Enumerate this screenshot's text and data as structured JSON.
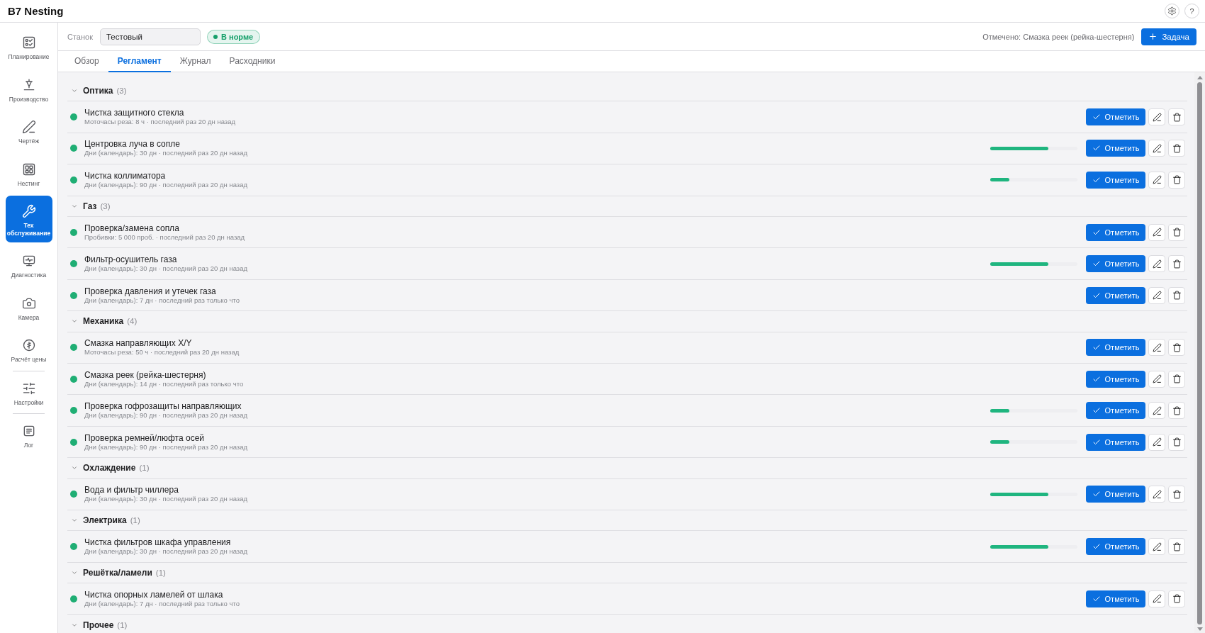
{
  "app": {
    "title": "B7 Nesting",
    "help_label": "?"
  },
  "sidebar": {
    "sections": [
      {
        "items": [
          {
            "kind": "planning",
            "label": "Планирование",
            "selected": false
          },
          {
            "kind": "production",
            "label": "Производство",
            "selected": false
          },
          {
            "kind": "drawing",
            "label": "Чертёж",
            "selected": false
          },
          {
            "kind": "nesting",
            "label": "Нестинг",
            "selected": false
          },
          {
            "kind": "maintenance",
            "label": "Тех обслуживание",
            "selected": true
          },
          {
            "kind": "diagnostics",
            "label": "Диагностика",
            "selected": false
          },
          {
            "kind": "camera",
            "label": "Камера",
            "selected": false
          },
          {
            "kind": "pricing",
            "label": "Расчёт цены",
            "selected": false
          }
        ]
      },
      {
        "items": [
          {
            "kind": "settings",
            "label": "Настройки",
            "selected": false
          }
        ]
      },
      {
        "items": [
          {
            "kind": "log",
            "label": "Лог",
            "selected": false
          }
        ]
      }
    ]
  },
  "toolbar": {
    "machine_label": "Станок",
    "machine_value": "Тестовый",
    "status": {
      "label": "В норме",
      "color": "#15a06a"
    },
    "marked_text": "Отмечено: Смазка реек (рейка-шестерня)",
    "add_button": "Задача"
  },
  "tabs": [
    {
      "label": "Обзор",
      "selected": false
    },
    {
      "label": "Регламент",
      "selected": true
    },
    {
      "label": "Журнал",
      "selected": false
    },
    {
      "label": "Расходники",
      "selected": false
    }
  ],
  "groups": [
    {
      "title": "Оптика",
      "count": "(3)",
      "expanded": true,
      "items": [
        {
          "title": "Чистка защитного стекла",
          "subtitle": "Моточасы реза: 8 ч · последний раз 20 дн назад",
          "color": "#1fae74",
          "action": "Отметить"
        },
        {
          "title": "Центровка луча в сопле",
          "subtitle": "Дни (календарь): 30 дн · последний раз 20 дн назад",
          "color": "#1fae74",
          "level": 0.67,
          "action": "Отметить"
        },
        {
          "title": "Чистка коллиматора",
          "subtitle": "Дни (календарь): 90 дн · последний раз 20 дн назад",
          "color": "#1fae74",
          "level": 0.22,
          "action": "Отметить"
        }
      ]
    },
    {
      "title": "Газ",
      "count": "(3)",
      "expanded": true,
      "items": [
        {
          "title": "Проверка/замена сопла",
          "subtitle": "Пробивки: 5 000 проб. · последний раз 20 дн назад",
          "color": "#1fae74",
          "action": "Отметить"
        },
        {
          "title": "Фильтр-осушитель газа",
          "subtitle": "Дни (календарь): 30 дн · последний раз 20 дн назад",
          "color": "#1fae74",
          "level": 0.67,
          "action": "Отметить"
        },
        {
          "title": "Проверка давления и утечек газа",
          "subtitle": "Дни (календарь): 7 дн · последний раз только что",
          "color": "#1fae74",
          "action": "Отметить"
        }
      ]
    },
    {
      "title": "Механика",
      "count": "(4)",
      "expanded": true,
      "items": [
        {
          "title": "Смазка направляющих X/Y",
          "subtitle": "Моточасы реза: 50 ч · последний раз 20 дн назад",
          "color": "#1fae74",
          "action": "Отметить"
        },
        {
          "title": "Смазка реек (рейка-шестерня)",
          "subtitle": "Дни (календарь): 14 дн · последний раз только что",
          "color": "#1fae74",
          "action": "Отметить"
        },
        {
          "title": "Проверка гофрозащиты направляющих",
          "subtitle": "Дни (календарь): 90 дн · последний раз 20 дн назад",
          "color": "#1fae74",
          "level": 0.22,
          "action": "Отметить"
        },
        {
          "title": "Проверка ремней/люфта осей",
          "subtitle": "Дни (календарь): 90 дн · последний раз 20 дн назад",
          "color": "#1fae74",
          "level": 0.22,
          "action": "Отметить"
        }
      ]
    },
    {
      "title": "Охлаждение",
      "count": "(1)",
      "expanded": true,
      "items": [
        {
          "title": "Вода и фильтр чиллера",
          "subtitle": "Дни (календарь): 30 дн · последний раз 20 дн назад",
          "color": "#1fae74",
          "level": 0.67,
          "action": "Отметить"
        }
      ]
    },
    {
      "title": "Электрика",
      "count": "(1)",
      "expanded": true,
      "items": [
        {
          "title": "Чистка фильтров шкафа управления",
          "subtitle": "Дни (календарь): 30 дн · последний раз 20 дн назад",
          "color": "#1fae74",
          "level": 0.67,
          "action": "Отметить"
        }
      ]
    },
    {
      "title": "Решётка/ламели",
      "count": "(1)",
      "expanded": true,
      "items": [
        {
          "title": "Чистка опорных ламелей от шлака",
          "subtitle": "Дни (календарь): 7 дн · последний раз только что",
          "color": "#1fae74",
          "action": "Отметить"
        }
      ]
    },
    {
      "title": "Прочее",
      "count": "(1)",
      "expanded": true
    }
  ]
}
